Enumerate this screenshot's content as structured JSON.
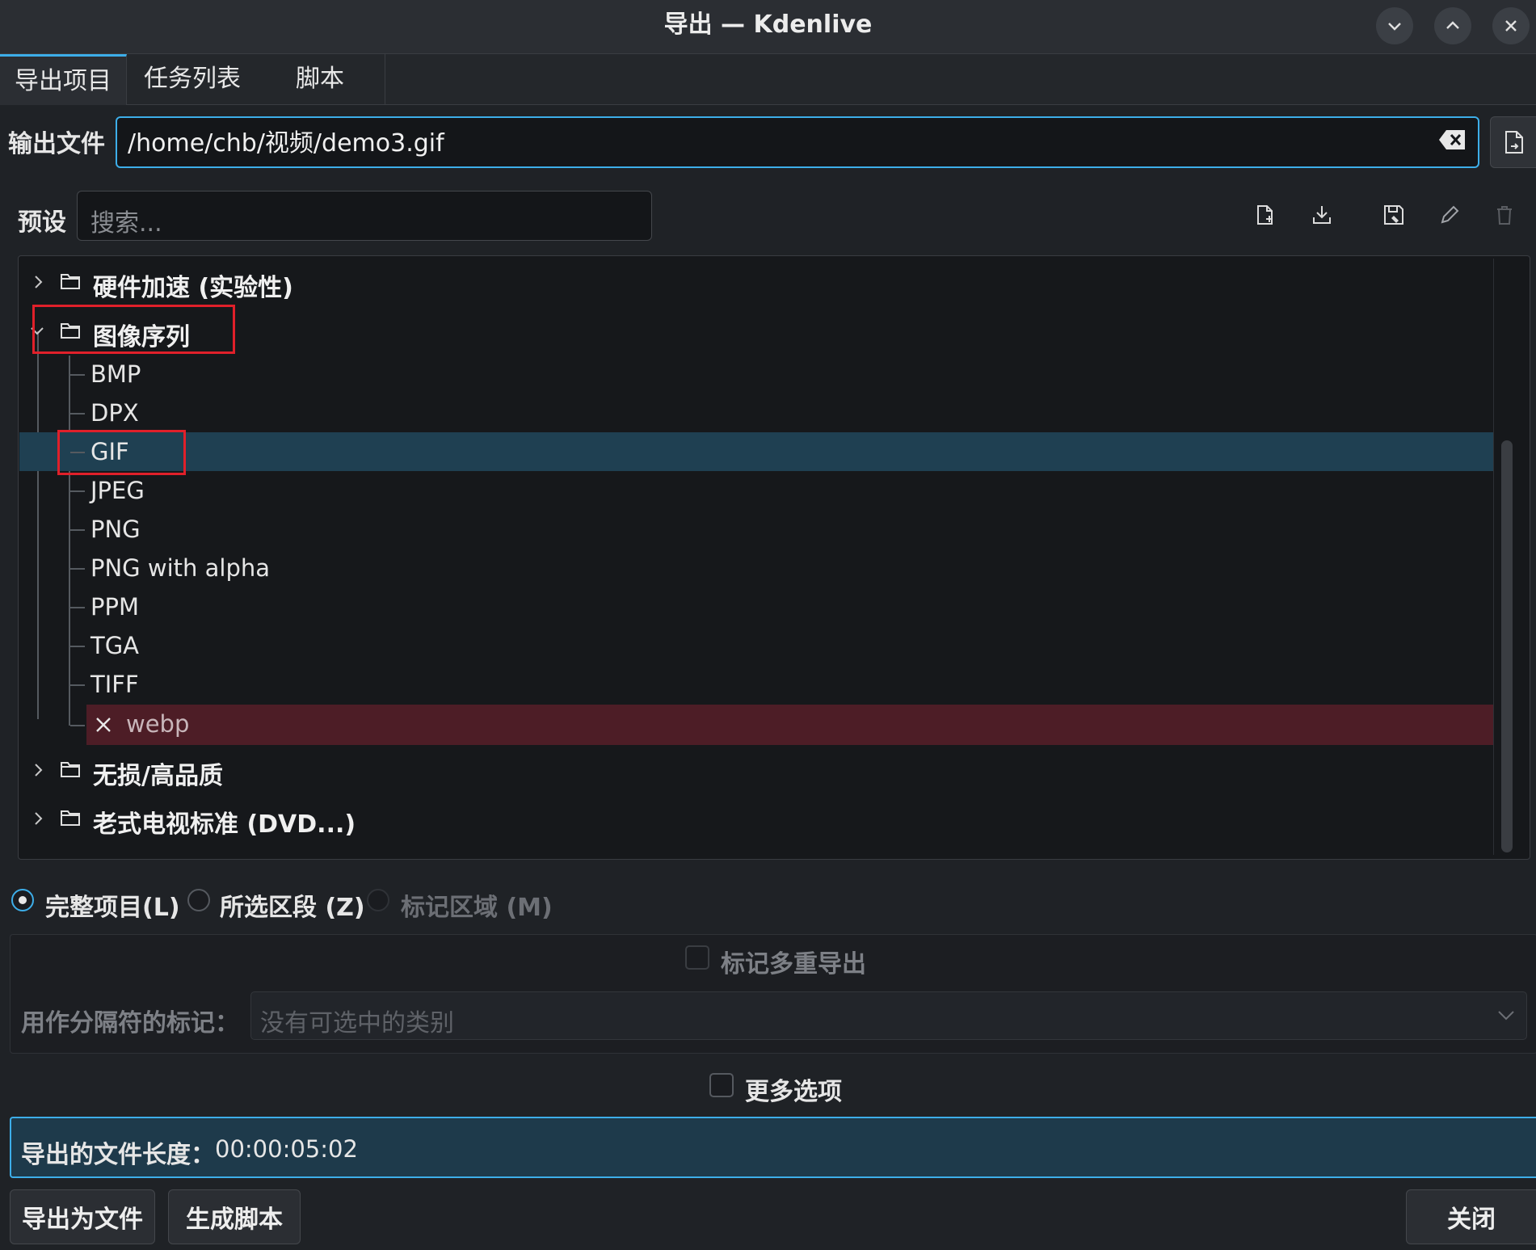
{
  "window": {
    "title": "导出 — Kdenlive"
  },
  "tabs": [
    {
      "label": "导出项目",
      "active": true
    },
    {
      "label": "任务列表",
      "active": false
    },
    {
      "label": "脚本",
      "active": false
    }
  ],
  "output": {
    "label": "输出文件",
    "value": "/home/chb/视频/demo3.gif"
  },
  "preset": {
    "label": "预设",
    "search_placeholder": "搜索...",
    "toolbar_icons": [
      "new-preset-icon",
      "download-icon",
      "save-preset-icon",
      "edit-icon",
      "delete-icon"
    ]
  },
  "tree": {
    "groups": [
      {
        "label": "硬件加速 (实验性)",
        "expanded": false
      },
      {
        "label": "图像序列",
        "expanded": true
      },
      {
        "label": "无损/高品质",
        "expanded": false
      },
      {
        "label": "老式电视标准 (DVD...)",
        "expanded": false
      }
    ],
    "image_sequence_items": [
      "BMP",
      "DPX",
      "GIF",
      "JPEG",
      "PNG",
      "PNG with alpha",
      "PPM",
      "TGA",
      "TIFF",
      "webp"
    ],
    "selected_item": "GIF",
    "error_item": "webp"
  },
  "range": {
    "full": "完整项目(L)",
    "selection": "所选区段 (Z)",
    "marked": "标记区域 (M)",
    "selected": "full"
  },
  "multi_export": {
    "checkbox_label": "标记多重导出",
    "separator_label": "用作分隔符的标记：",
    "separator_placeholder": "没有可选中的类别"
  },
  "more_options": {
    "label": "更多选项",
    "checked": false
  },
  "duration": {
    "label": "导出的文件长度：",
    "value": "00:00:05:02"
  },
  "buttons": {
    "export": "导出为文件",
    "script": "生成脚本",
    "close": "关闭"
  },
  "colors": {
    "accent": "#3daee9",
    "selection": "#1f4052",
    "error": "#4d1d26",
    "highlight_box": "#e0202a"
  }
}
